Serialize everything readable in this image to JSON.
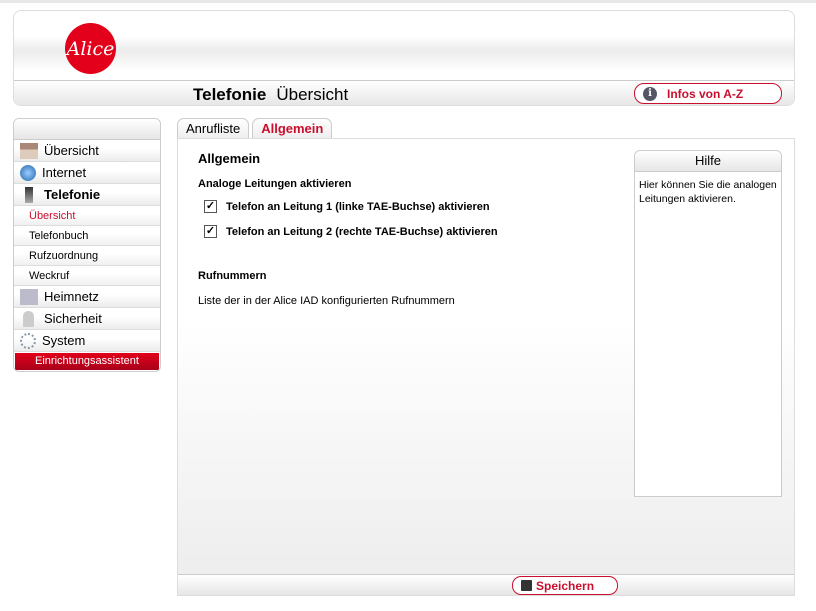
{
  "header": {
    "logo": "Alice",
    "title_bold": "Telefonie",
    "title": "Übersicht",
    "infos_label": "Infos von A-Z"
  },
  "sidebar": {
    "items": [
      {
        "label": "Übersicht",
        "icon": "house-icon"
      },
      {
        "label": "Internet",
        "icon": "globe-icon"
      },
      {
        "label": "Telefonie",
        "icon": "phone-icon"
      },
      {
        "label": "Heimnetz",
        "icon": "network-icon"
      },
      {
        "label": "Sicherheit",
        "icon": "lock-icon"
      },
      {
        "label": "System",
        "icon": "gears-icon"
      }
    ],
    "subitems": [
      "Übersicht",
      "Telefonbuch",
      "Rufzuordnung",
      "Weckruf"
    ],
    "wizard": "Einrichtungsassistent"
  },
  "tabs": [
    "Anrufliste",
    "Allgemein"
  ],
  "main": {
    "heading": "Allgemein",
    "section1": "Analoge Leitungen aktivieren",
    "checkboxes": [
      {
        "label": "Telefon an Leitung 1 (linke TAE-Buchse) aktivieren",
        "checked": true
      },
      {
        "label": "Telefon an Leitung 2 (rechte TAE-Buchse) aktivieren",
        "checked": true
      }
    ],
    "section2": "Rufnummern",
    "section2_text": "Liste der in der Alice IAD konfigurierten Rufnummern"
  },
  "help": {
    "title": "Hilfe",
    "text": "Hier können Sie die analogen Leitungen aktivieren."
  },
  "footer": {
    "save_label": "Speichern"
  }
}
